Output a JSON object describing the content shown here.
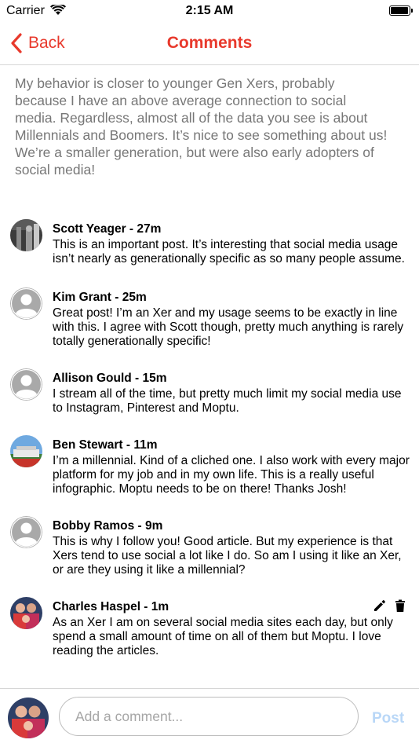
{
  "status_bar": {
    "carrier": "Carrier",
    "time": "2:15 AM",
    "battery_level": 1.0
  },
  "nav": {
    "back_label": "Back",
    "title": "Comments",
    "accent_color": "#e8392c"
  },
  "post": {
    "text": "My behavior is closer to younger Gen Xers, probably because I have an above average connection to social media. Regardless, almost all of the data you see is about Millennials and Boomers. It’s nice to see something about us! We’re a smaller generation, but were also early adopters of social media!"
  },
  "comments": [
    {
      "header": "Scott Yeager - 27m",
      "text": "This is an important post. It’s interesting that social media usage isn’t nearly as generationally specific as so many people assume.",
      "avatar": "photo"
    },
    {
      "header": "Kim Grant - 25m",
      "text": "Great post! I’m an Xer and my usage seems to be exactly in line with this. I agree with Scott though, pretty much anything is rarely totally generationally specific!",
      "avatar": "placeholder"
    },
    {
      "header": "Allison Gould - 15m",
      "text": "I stream all of the time, but pretty much limit my social media use to Instagram, Pinterest and Moptu.",
      "avatar": "placeholder"
    },
    {
      "header": "Ben Stewart - 11m",
      "text": "I’m a millennial. Kind of a cliched one. I also work with every major platform for my job and in my own life. This is a really useful infographic. Moptu needs to be on there! Thanks Josh!",
      "avatar": "photo"
    },
    {
      "header": "Bobby Ramos - 9m",
      "text": "This is why I follow you! Good article. But my experience is that Xers tend to use social a lot like I do. So am I using it like an Xer, or are they using it like a millennial?",
      "avatar": "placeholder"
    },
    {
      "header": "Charles Haspel - 1m",
      "text": "As an Xer I am on several social media sites each day, but only spend a small amount of time on all of them but Moptu. I love reading the articles.",
      "avatar": "photo",
      "editable": true
    }
  ],
  "composer": {
    "placeholder": "Add a comment...",
    "post_label": "Post",
    "post_color": "#b9d7f7"
  }
}
